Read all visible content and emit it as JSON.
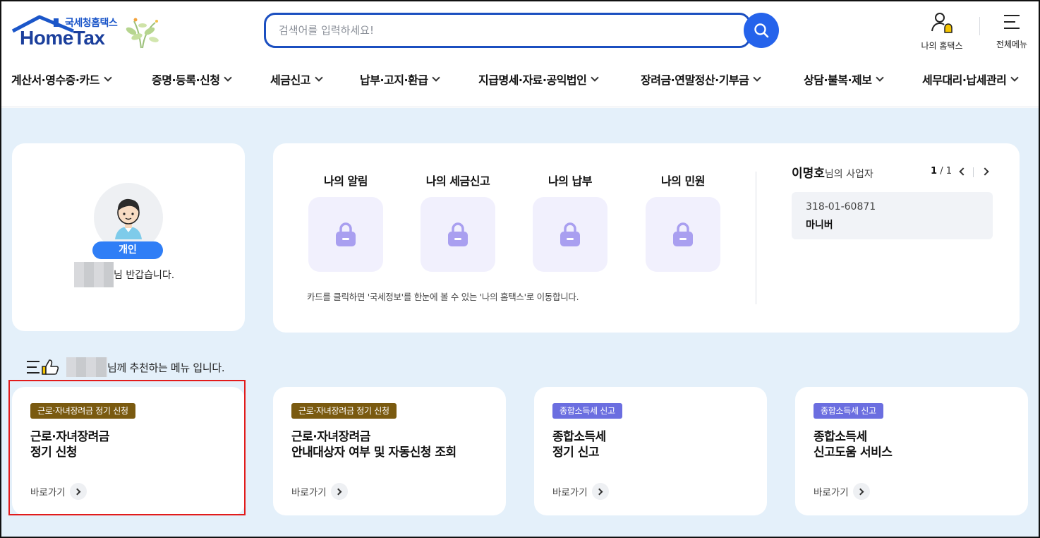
{
  "header": {
    "logo_kor": "국세청홈택스",
    "logo_eng": "HomeTax",
    "search_placeholder": "검색어를 입력하세요!",
    "my_hometax": "나의 홈택스",
    "all_menu": "전체메뉴"
  },
  "nav": [
    {
      "label": "계산서·영수증·카드"
    },
    {
      "label": "증명·등록·신청"
    },
    {
      "label": "세금신고"
    },
    {
      "label": "납부·고지·환급"
    },
    {
      "label": "지급명세·자료·공익법인"
    },
    {
      "label": "장려금·연말정산·기부금"
    },
    {
      "label": "상담·불복·제보"
    },
    {
      "label": "세무대리·납세관리"
    }
  ],
  "profile": {
    "user_type": "개인",
    "greeting": "님 반갑습니다."
  },
  "status": {
    "items": [
      {
        "title": "나의 알림"
      },
      {
        "title": "나의 세금신고"
      },
      {
        "title": "나의 납부"
      },
      {
        "title": "나의 민원"
      }
    ],
    "note": "카드를 클릭하면 '국세정보'를 한눈에 볼 수 있는 '나의 홈택스'로 이동합니다.",
    "business": {
      "owner": "이명호",
      "owner_suffix": "님의 사업자",
      "page_current": "1",
      "page_total": "/ 1",
      "reg_no": "318-01-60871",
      "name": "마니버"
    }
  },
  "recommend": {
    "heading": "님께 추천하는 메뉴 입니다.",
    "cards": [
      {
        "tag": "근로·자녀장려금 정기 신청",
        "tag_color": "#7a5a10",
        "line1": "근로·자녀장려금",
        "line2": "정기 신청",
        "go": "바로가기"
      },
      {
        "tag": "근로·자녀장려금 정기 신청",
        "tag_color": "#7a5a10",
        "line1": "근로·자녀장려금",
        "line2": "안내대상자 여부 및 자동신청 조회",
        "go": "바로가기"
      },
      {
        "tag": "종합소득세 신고",
        "tag_color": "#6b6ee0",
        "line1": "종합소득세",
        "line2": "정기 신고",
        "go": "바로가기"
      },
      {
        "tag": "종합소득세 신고",
        "tag_color": "#6b6ee0",
        "line1": "종합소득세",
        "line2": "신고도움 서비스",
        "go": "바로가기"
      }
    ]
  },
  "icons": {
    "search": "search-icon",
    "user_bell": "user-bell-icon",
    "menu": "hamburger-menu-icon",
    "lock": "lock-icon",
    "recommend": "thumbs-up-list-icon"
  },
  "colors": {
    "brand_blue": "#2563eb",
    "page_bg": "#e4f0fa",
    "lock_purple": "#a99ff0",
    "user_tag": "#2f7ef6",
    "highlight": "#e21b1b"
  }
}
